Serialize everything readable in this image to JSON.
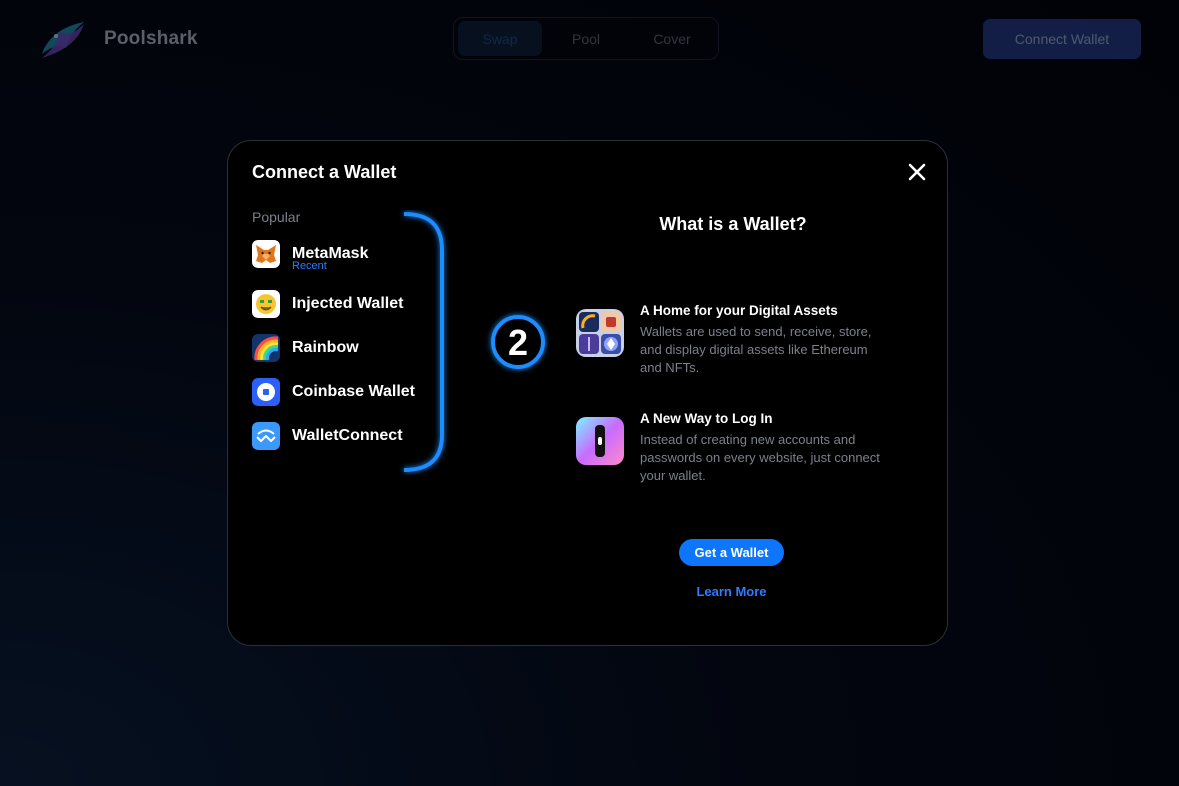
{
  "header": {
    "brand": "Poolshark",
    "tabs": [
      {
        "label": "Swap",
        "active": true
      },
      {
        "label": "Pool",
        "active": false
      },
      {
        "label": "Cover",
        "active": false
      }
    ],
    "connect_label": "Connect Wallet"
  },
  "modal": {
    "title": "Connect a Wallet",
    "section_label": "Popular",
    "wallets": [
      {
        "name": "MetaMask",
        "sub": "Recent",
        "icon": "metamask-fox-icon"
      },
      {
        "name": "Injected Wallet",
        "icon": "money-face-icon"
      },
      {
        "name": "Rainbow",
        "icon": "rainbow-icon"
      },
      {
        "name": "Coinbase Wallet",
        "icon": "coinbase-icon"
      },
      {
        "name": "WalletConnect",
        "icon": "walletconnect-icon"
      }
    ],
    "annotation_number": "2",
    "right": {
      "title": "What is a Wallet?",
      "features": [
        {
          "title": "A Home for your Digital Assets",
          "text": "Wallets are used to send, receive, store, and display digital assets like Ethereum and NFTs."
        },
        {
          "title": "A New Way to Log In",
          "text": "Instead of creating new accounts and passwords on every website, just connect your wallet."
        }
      ],
      "get_wallet": "Get a Wallet",
      "learn_more": "Learn More"
    }
  },
  "colors": {
    "accent": "#0e76fd",
    "link": "#2f7bff",
    "annotation": "#1a8cff"
  }
}
